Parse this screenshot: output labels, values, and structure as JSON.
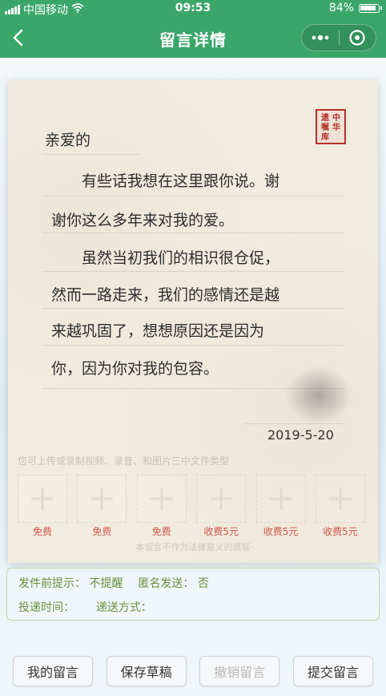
{
  "status_bar": {
    "carrier": "中国移动",
    "time": "09:53",
    "battery": "84%",
    "battery_level": 0.84
  },
  "nav": {
    "title": "留言详情"
  },
  "letter": {
    "seal_text": "中华遗嘱库",
    "salutation": "亲爱的",
    "lines": [
      "　　有些话我想在这里跟你说。谢",
      "谢你这么多年来对我的爱。",
      "　　虽然当初我们的相识很仓促，",
      "然而一路走来，我们的感情还是越",
      "来越巩固了，想想原因还是因为",
      "你，因为你对我的包容。"
    ],
    "date": "2019-5-20",
    "upload_hint": "您可上传或录制视频、录音、和图片三中文件类型",
    "upload_slots": [
      "免费",
      "免费",
      "免费",
      "收费5元",
      "收费5元",
      "收费5元"
    ],
    "disclaimer": "·本留言不作为法律意义的遗嘱·"
  },
  "info": {
    "send_tip_label": "发件前提示：",
    "send_tip_value": "不提醒",
    "anon_label": "匿名发送：",
    "anon_value": "否",
    "deliver_time_label": "投递时间：",
    "deliver_method_label": "递送方式："
  },
  "buttons": {
    "my_messages": "我的留言",
    "save_draft": "保存草稿",
    "revoke": "撤销留言",
    "submit": "提交留言"
  },
  "colors": {
    "primary": "#3aa66a",
    "seal": "#b5302c",
    "price": "#d2554a",
    "info_text": "#6a8f3d"
  }
}
